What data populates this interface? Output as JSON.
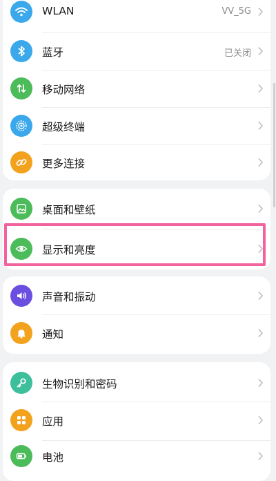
{
  "cards": [
    {
      "items": [
        {
          "name": "wlan",
          "label": "WLAN",
          "value": "VV_5G",
          "icon": "wifi-icon",
          "color": "#3aa8ea"
        },
        {
          "name": "bluetooth",
          "label": "蓝牙",
          "value": "已关闭",
          "icon": "bluetooth-icon",
          "color": "#3aa8ea"
        },
        {
          "name": "mobile-network",
          "label": "移动网络",
          "value": "",
          "icon": "mobile-data-icon",
          "color": "#4cbb5a"
        },
        {
          "name": "super-terminal",
          "label": "超级终端",
          "value": "",
          "icon": "super-terminal-icon",
          "color": "#3aa8ea"
        },
        {
          "name": "more-connections",
          "label": "更多连接",
          "value": "",
          "icon": "link-icon",
          "color": "#f3a21d"
        }
      ]
    },
    {
      "items": [
        {
          "name": "wallpaper",
          "label": "桌面和壁纸",
          "value": "",
          "icon": "wallpaper-icon",
          "color": "#4cbb5a"
        },
        {
          "name": "display-brightness",
          "label": "显示和亮度",
          "value": "",
          "icon": "eye-icon",
          "color": "#4cbb5a"
        }
      ]
    },
    {
      "items": [
        {
          "name": "sound-vibration",
          "label": "声音和振动",
          "value": "",
          "icon": "speaker-icon",
          "color": "#6a4fe0"
        },
        {
          "name": "notifications",
          "label": "通知",
          "value": "",
          "icon": "bell-icon",
          "color": "#f3a21d"
        }
      ]
    },
    {
      "items": [
        {
          "name": "biometrics-password",
          "label": "生物识别和密码",
          "value": "",
          "icon": "key-icon",
          "color": "#3dbf9b"
        },
        {
          "name": "apps",
          "label": "应用",
          "value": "",
          "icon": "apps-grid-icon",
          "color": "#f3a21d"
        },
        {
          "name": "battery",
          "label": "电池",
          "value": "",
          "icon": "battery-icon",
          "color": "#4cbb5a"
        }
      ]
    }
  ],
  "highlight_color": "#f2639d"
}
